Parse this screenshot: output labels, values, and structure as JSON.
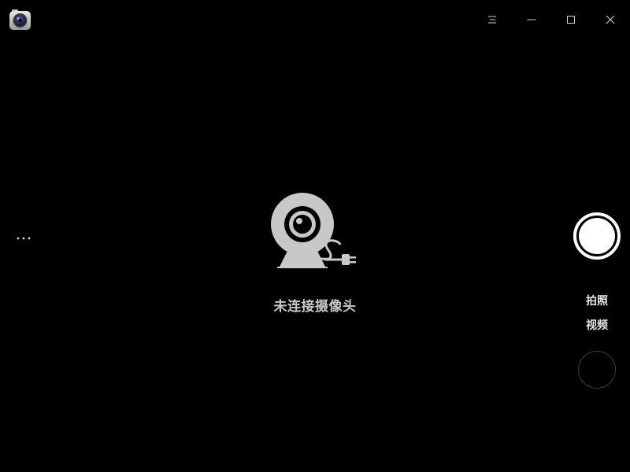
{
  "window": {
    "app_icon": "camera-app-icon",
    "controls": {
      "menu_icon": "hamburger-menu-icon",
      "minimize_icon": "minimize-icon",
      "maximize_icon": "maximize-icon",
      "close_icon": "close-icon"
    }
  },
  "left_panel": {
    "more_icon": "more-options-icon"
  },
  "center": {
    "illustration_icon": "disconnected-webcam-icon",
    "status_text": "未连接摄像头"
  },
  "right_panel": {
    "shutter_icon": "shutter-icon",
    "modes": [
      {
        "label": "拍照"
      },
      {
        "label": "视频"
      }
    ],
    "thumbnail_icon": "gallery-thumbnail"
  },
  "colors": {
    "background": "#000000",
    "illustration": "#c8c8c8",
    "text": "#e6e6e6",
    "shutter": "#ffffff"
  }
}
